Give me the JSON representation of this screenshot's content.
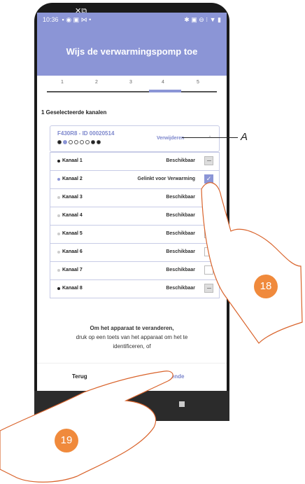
{
  "status_bar": {
    "time": "10:36"
  },
  "header": {
    "title": "Wijs de verwarmingspomp toe"
  },
  "steps": [
    "1",
    "2",
    "3",
    "4",
    "5"
  ],
  "active_step": 4,
  "selected_label": "1 Geselecteerde kanalen",
  "device": {
    "title": "F430R8 - ID 00020514",
    "remove_label": "Verwijderen",
    "chevron": "⌃"
  },
  "channels": [
    {
      "name": "Kanaal 1",
      "status": "Beschikbaar",
      "bullet": "dark",
      "check": "disabled"
    },
    {
      "name": "Kanaal 2",
      "status": "Gelinkt voor Verwarming",
      "bullet": "blue",
      "check": "checked"
    },
    {
      "name": "Kanaal 3",
      "status": "Beschikbaar",
      "bullet": "light",
      "check": "empty"
    },
    {
      "name": "Kanaal 4",
      "status": "Beschikbaar",
      "bullet": "light",
      "check": "empty"
    },
    {
      "name": "Kanaal 5",
      "status": "Beschikbaar",
      "bullet": "light",
      "check": "empty"
    },
    {
      "name": "Kanaal 6",
      "status": "Beschikbaar",
      "bullet": "light",
      "check": "empty"
    },
    {
      "name": "Kanaal 7",
      "status": "Beschikbaar",
      "bullet": "light",
      "check": "empty"
    },
    {
      "name": "Kanaal 8",
      "status": "Beschikbaar",
      "bullet": "dark",
      "check": "disabled"
    }
  ],
  "info": {
    "line1": "Om het apparaat te veranderen,",
    "line2": "druk op een toets van het apparaat om het te",
    "line3": "identificeren, of"
  },
  "buttons": {
    "back": "Terug",
    "next": "Volgende"
  },
  "annotations": {
    "callout": "A",
    "badge1": "18",
    "badge2": "19"
  },
  "colors": {
    "accent": "#8b95d6",
    "badge": "#f08a3c"
  }
}
